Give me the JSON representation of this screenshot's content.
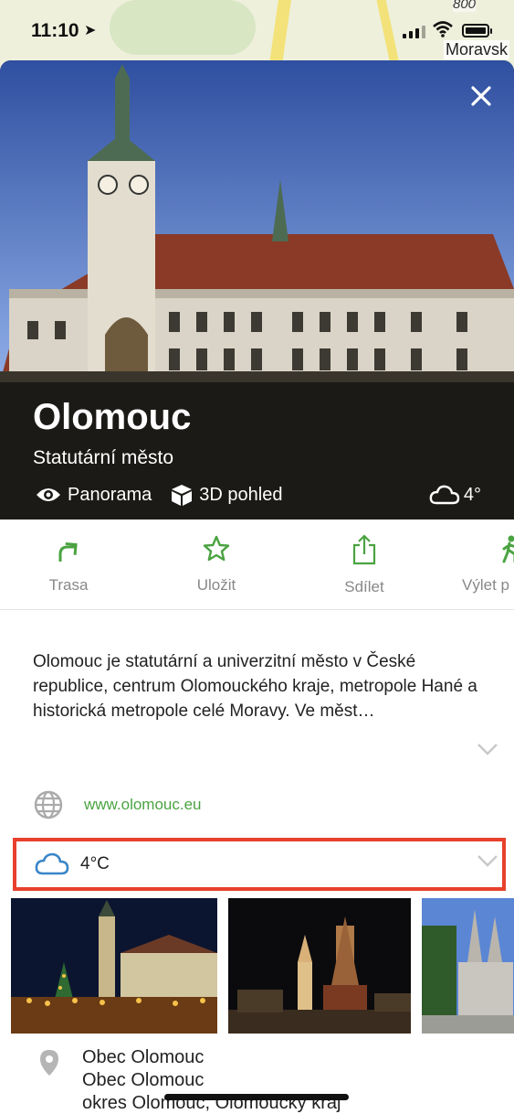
{
  "map": {
    "elevation_label": "800",
    "place_label": "Moravsk"
  },
  "status": {
    "time": "11:10"
  },
  "hero": {
    "title": "Olomouc",
    "subtitle": "Statutární město",
    "panorama_label": "Panorama",
    "view3d_label": "3D pohled",
    "temperature": "4°"
  },
  "actions": [
    {
      "label": "Trasa",
      "icon": "route-arrow-icon"
    },
    {
      "label": "Uložit",
      "icon": "star-icon"
    },
    {
      "label": "Sdílet",
      "icon": "share-icon"
    },
    {
      "label": "Výlet p",
      "icon": "hiker-icon"
    }
  ],
  "description": "Olomouc je statutární a univerzitní město v České republice, centrum Olomouckého kraje, metropole Hané a historická metropole celé Moravy. Ve měst…",
  "website": "www.olomouc.eu",
  "weather": {
    "text": "4°C"
  },
  "address": {
    "line1": "Obec Olomouc",
    "line2": "Obec Olomouc",
    "line3": "okres Olomouc, Olomoucký kraj"
  },
  "colors": {
    "accent": "#4aa341",
    "highlight": "#e8402c",
    "hero_bg": "#1c1a16"
  }
}
